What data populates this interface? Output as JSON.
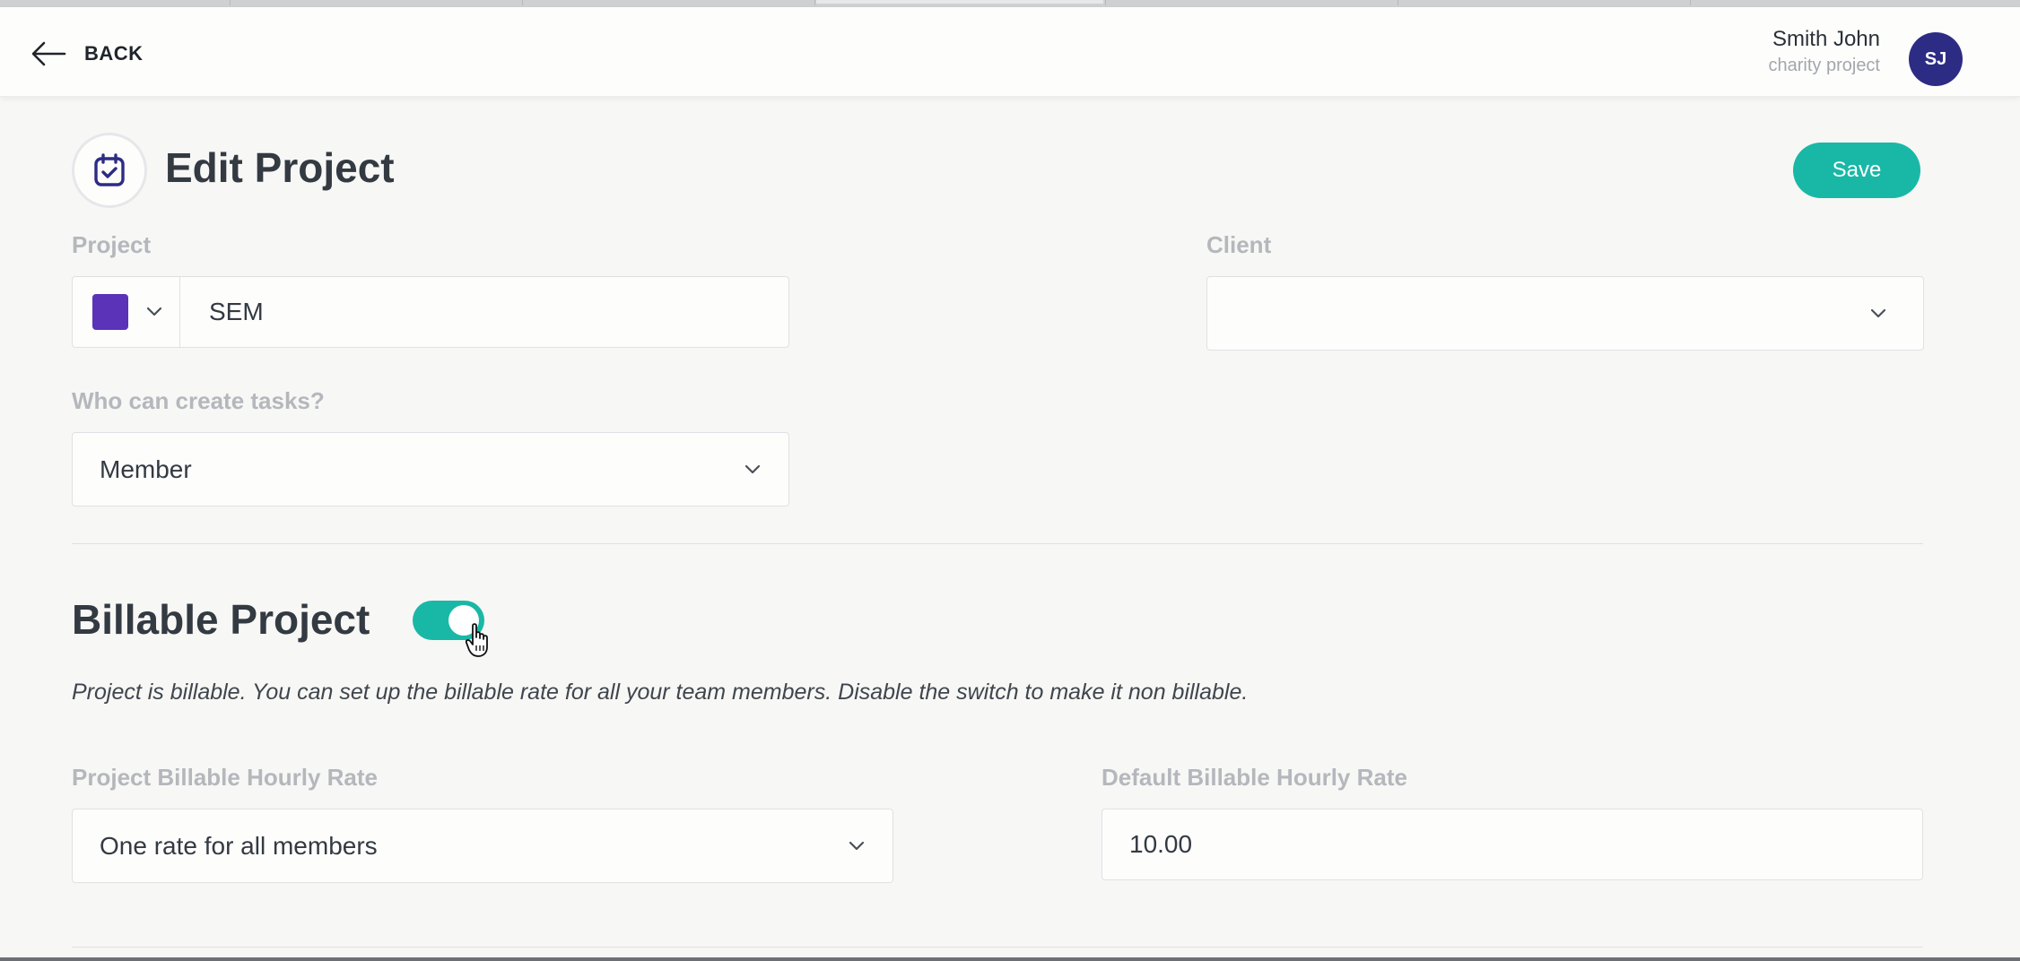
{
  "header": {
    "back_label": "BACK",
    "user_name": "Smith John",
    "user_subtitle": "charity project",
    "avatar_initials": "SJ"
  },
  "page": {
    "title": "Edit Project",
    "save_label": "Save"
  },
  "form": {
    "project_label": "Project",
    "project_value": "SEM",
    "project_color": "#5a33b9",
    "client_label": "Client",
    "client_value": "",
    "tasks_label": "Who can create tasks?",
    "tasks_value": "Member"
  },
  "billable": {
    "title": "Billable Project",
    "enabled": true,
    "description": "Project is billable. You can set up the billable rate for all your team members. Disable the switch to make it non billable.",
    "rate_type_label": "Project Billable Hourly Rate",
    "rate_type_value": "One rate for all members",
    "default_rate_label": "Default Billable Hourly Rate",
    "default_rate_value": "10.00"
  },
  "colors": {
    "accent": "#19b8a6",
    "avatar": "#2d2c84",
    "icon": "#2d2c84"
  }
}
